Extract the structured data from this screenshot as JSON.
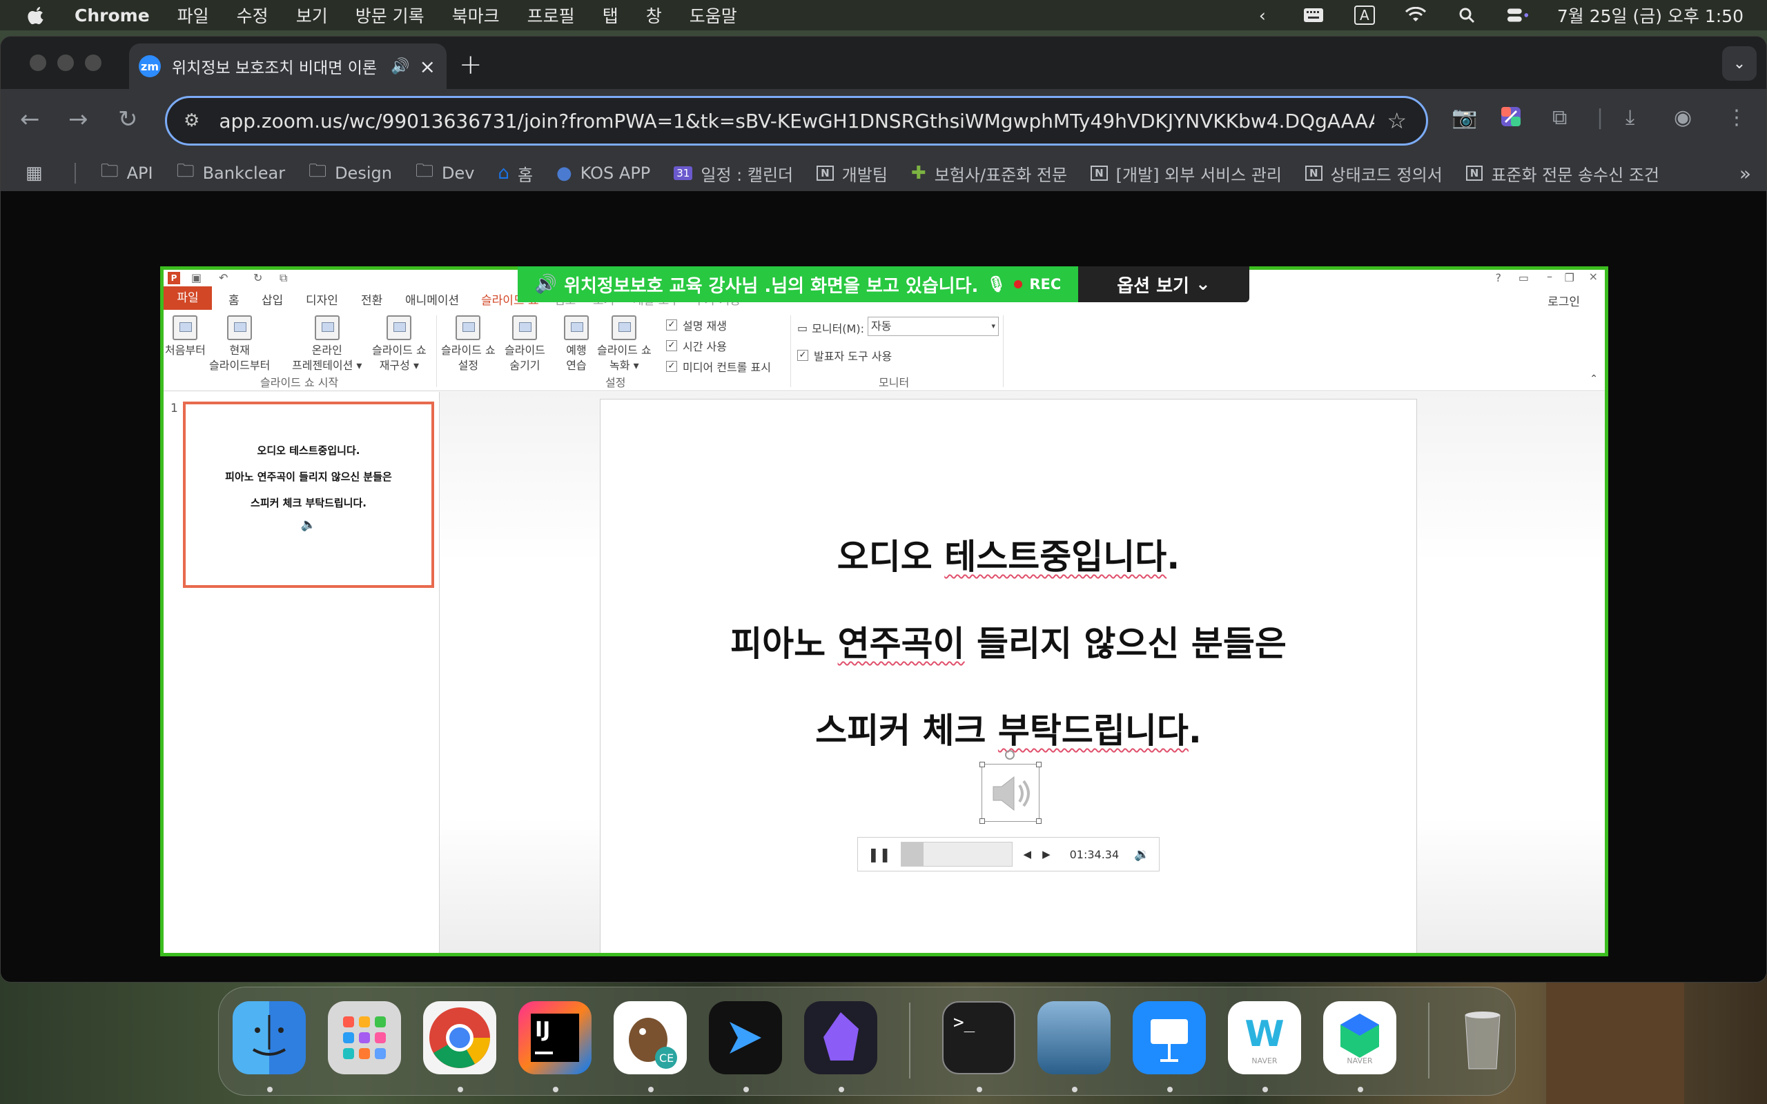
{
  "menubar": {
    "app_name": "Chrome",
    "items": [
      "파일",
      "수정",
      "보기",
      "방문 기록",
      "북마크",
      "프로필",
      "탭",
      "창",
      "도움말"
    ],
    "input_indicator": "A",
    "clock": "7월 25일 (금) 오후 1:50"
  },
  "tab": {
    "favicon": "zm",
    "title": "위치정보 보호조치 비대면 이론"
  },
  "omnibox": {
    "url": "app.zoom.us/wc/99013636731/join?fromPWA=1&tk=sBV-KEwGH1DNSRGthsiWMgwphMTy49hVDKJYNVKKbw4.DQgAAAAX..."
  },
  "bookmarks": [
    {
      "label": "API",
      "icon": "folder-icon"
    },
    {
      "label": "Bankclear",
      "icon": "folder-icon"
    },
    {
      "label": "Design",
      "icon": "folder-icon"
    },
    {
      "label": "Dev",
      "icon": "folder-icon"
    },
    {
      "label": "홈",
      "icon": "home-icon"
    },
    {
      "label": "KOS APP",
      "icon": "app-icon"
    },
    {
      "label": "일정 : 캘린더",
      "icon": "calendar-icon",
      "badge": "31"
    },
    {
      "label": "개발팀",
      "icon": "notion-icon"
    },
    {
      "label": "보험사/표준화 전문",
      "icon": "puzzle-icon"
    },
    {
      "label": "[개발] 외부 서비스 관리",
      "icon": "notion-icon"
    },
    {
      "label": "상태코드 정의서",
      "icon": "notion-icon"
    },
    {
      "label": "표준화 전문 송수신 조건",
      "icon": "notion-icon"
    }
  ],
  "zoom": {
    "banner_text": "위치정보보호 교육 강사님 .님의 화면을 보고 있습니다.",
    "rec": "REC",
    "options_label": "옵션 보기"
  },
  "ppt": {
    "tabs": [
      "파일",
      "홈",
      "삽입",
      "디자인",
      "전환",
      "애니메이션",
      "슬라이드 쇼",
      "검토",
      "보기",
      "개발 도구",
      "추가 기능"
    ],
    "login": "로그인",
    "ribbon": {
      "from_start": "처음부터",
      "from_current_1": "현재",
      "from_current_2": "슬라이드부터",
      "online_1": "온라인",
      "online_2": "프레젠테이션",
      "custom_1": "슬라이드 쇼",
      "custom_2": "재구성",
      "group_start": "슬라이드 쇼 시작",
      "setup_1": "슬라이드 쇼",
      "setup_2": "설정",
      "hide_1": "슬라이드",
      "hide_2": "숨기기",
      "rehearse_1": "예행",
      "rehearse_2": "연습",
      "record_1": "슬라이드 쇼",
      "record_2": "녹화",
      "chk_narration": "설명 재생",
      "chk_timing": "시간 사용",
      "chk_media": "미디어 컨트롤 표시",
      "group_setup": "설정",
      "monitor_label": "모니터(M):",
      "monitor_value": "자동",
      "chk_presenter": "발표자 도구 사용",
      "group_monitor": "모니터"
    },
    "slide_number": "1",
    "slide_lines": [
      "오디오 테스트중입니다.",
      "피아노 연주곡이 들리지 않으신 분들은",
      "스피커 체크 부탁드립니다."
    ],
    "player": {
      "time": "01:34.34",
      "progress": 0.2
    }
  },
  "dock": [
    "Finder",
    "Launchpad",
    "Chrome",
    "IntelliJ IDEA",
    "DBeaver CE",
    "Cursor",
    "Obsidian",
    "Terminal",
    "Preview",
    "Keynote",
    "Whale",
    "NAVER Works"
  ],
  "colors": {
    "zoom_green": "#28c840",
    "share_border": "#3cbd1f",
    "ppt_orange": "#d24726",
    "omnibox_focus": "#7cacf8"
  }
}
